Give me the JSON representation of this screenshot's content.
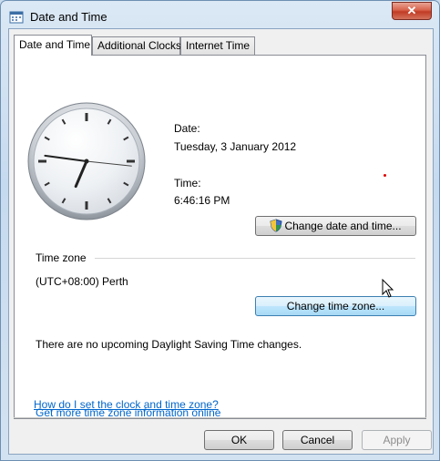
{
  "window": {
    "title": "Date and Time",
    "close_label": "✕"
  },
  "tabs": [
    {
      "label": "Date and Time"
    },
    {
      "label": "Additional Clocks"
    },
    {
      "label": "Internet Time"
    }
  ],
  "datetime": {
    "date_label": "Date:",
    "date_value": "Tuesday, 3 January 2012",
    "time_label": "Time:",
    "time_value": "6:46:16 PM",
    "change_button": "Change date and time..."
  },
  "timezone": {
    "section_label": "Time zone",
    "value": "(UTC+08:00) Perth",
    "change_button": "Change time zone...",
    "dst_note": "There are no upcoming Daylight Saving Time changes."
  },
  "links": {
    "more_info": "Get more time zone information online",
    "how_to": "How do I set the clock and time zone?"
  },
  "footer": {
    "ok": "OK",
    "cancel": "Cancel",
    "apply": "Apply"
  },
  "clock": {
    "hours": 6,
    "minutes": 46,
    "seconds": 16
  },
  "colors": {
    "link": "#0066cc",
    "hover_button": "#bee6fd"
  }
}
